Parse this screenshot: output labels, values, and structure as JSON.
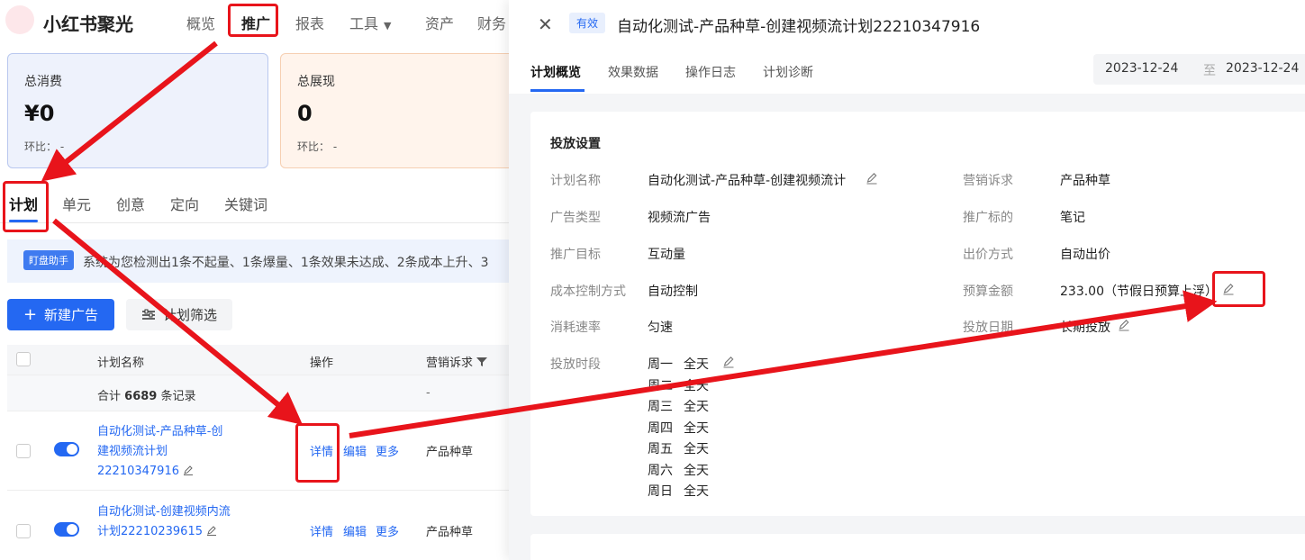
{
  "app": {
    "brand": "小红书聚光",
    "nav": [
      {
        "label": "概览",
        "active": false
      },
      {
        "label": "推广",
        "active": true
      },
      {
        "label": "报表",
        "active": false
      },
      {
        "label": "工具",
        "active": false
      },
      {
        "label": "资产",
        "active": false
      },
      {
        "label": "财务",
        "active": false
      }
    ]
  },
  "cards": [
    {
      "label": "总消费",
      "value": "¥0",
      "ratio": "环比： -"
    },
    {
      "label": "总展现",
      "value": "0",
      "ratio": "环比： -"
    }
  ],
  "subtabs": [
    "计划",
    "单元",
    "创意",
    "定向",
    "关键词"
  ],
  "notice": {
    "badge": "盯盘助手",
    "text": "系统为您检测出1条不起量、1条爆量、1条效果未达成、2条成本上升、3"
  },
  "toolbar": {
    "new_label": "新建广告",
    "filter_label": "计划筛选"
  },
  "table": {
    "headers": {
      "name": "计划名称",
      "op": "操作",
      "goal": "营销诉求"
    },
    "summary": {
      "prefix": "合计",
      "count": "6689",
      "suffix": "条记录",
      "goal": "-"
    },
    "rows": [
      {
        "name": "自动化测试-产品种草-创建视频流计划22210347916",
        "ops": [
          "详情",
          "编辑",
          "更多"
        ],
        "goal": "产品种草"
      },
      {
        "name": "自动化测试-创建视频内流计划22210239615",
        "ops": [
          "详情",
          "编辑",
          "更多"
        ],
        "goal": "产品种草"
      }
    ]
  },
  "drawer": {
    "status": "有效",
    "title": "自动化测试-产品种草-创建视频流计划22210347916",
    "tabs": [
      "计划概览",
      "效果数据",
      "操作日志",
      "计划诊断"
    ],
    "date_from": "2023-12-24",
    "date_sep": "至",
    "date_to": "2023-12-24",
    "section_title": "投放设置",
    "fields_left": [
      {
        "k": "计划名称",
        "v": "自动化测试-产品种草-创建视频流计"
      },
      {
        "k": "广告类型",
        "v": "视频流广告"
      },
      {
        "k": "推广目标",
        "v": "互动量"
      },
      {
        "k": "成本控制方式",
        "v": "自动控制"
      },
      {
        "k": "消耗速率",
        "v": "匀速"
      },
      {
        "k": "投放时段",
        "v": ""
      }
    ],
    "fields_right": [
      {
        "k": "营销诉求",
        "v": "产品种草"
      },
      {
        "k": "推广标的",
        "v": "笔记"
      },
      {
        "k": "出价方式",
        "v": "自动出价"
      },
      {
        "k": "预算金额",
        "v": "233.00（节假日预算上浮）"
      },
      {
        "k": "投放日期",
        "v": "长期投放"
      }
    ],
    "schedule": [
      {
        "day": "周一",
        "time": "全天"
      },
      {
        "day": "周二",
        "time": "全天"
      },
      {
        "day": "周三",
        "time": "全天"
      },
      {
        "day": "周四",
        "time": "全天"
      },
      {
        "day": "周五",
        "time": "全天"
      },
      {
        "day": "周六",
        "time": "全天"
      },
      {
        "day": "周日",
        "time": "全天"
      }
    ]
  },
  "colors": {
    "accent": "#2468f2",
    "annotation": "#e8141b"
  }
}
